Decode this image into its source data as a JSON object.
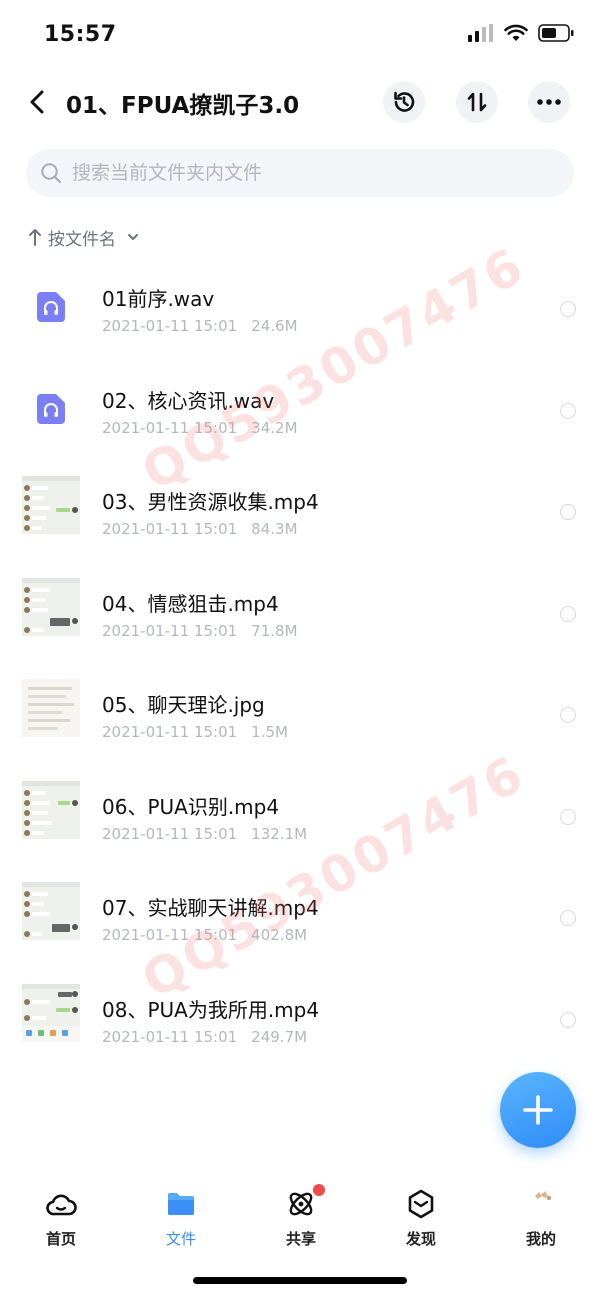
{
  "status": {
    "time": "15:57"
  },
  "header": {
    "title": "01、FPUA撩凯子3.0"
  },
  "search": {
    "placeholder": "搜索当前文件夹内文件"
  },
  "sort": {
    "label": "按文件名"
  },
  "files": [
    {
      "name": "01前序.wav",
      "date": "2021-01-11 15:01",
      "size": "24.6M",
      "type": "audio"
    },
    {
      "name": "02、核心资讯.wav",
      "date": "2021-01-11 15:01",
      "size": "34.2M",
      "type": "audio"
    },
    {
      "name": "03、男性资源收集.mp4",
      "date": "2021-01-11 15:01",
      "size": "84.3M",
      "type": "video"
    },
    {
      "name": "04、情感狙击.mp4",
      "date": "2021-01-11 15:01",
      "size": "71.8M",
      "type": "video"
    },
    {
      "name": "05、聊天理论.jpg",
      "date": "2021-01-11 15:01",
      "size": "1.5M",
      "type": "image"
    },
    {
      "name": "06、PUA识别.mp4",
      "date": "2021-01-11 15:01",
      "size": "132.1M",
      "type": "video"
    },
    {
      "name": "07、实战聊天讲解.mp4",
      "date": "2021-01-11 15:01",
      "size": "402.8M",
      "type": "video"
    },
    {
      "name": "08、PUA为我所用.mp4",
      "date": "2021-01-11 15:01",
      "size": "249.7M",
      "type": "video"
    }
  ],
  "watermark": {
    "text": "QQ593007476"
  },
  "tabs": [
    {
      "label": "首页"
    },
    {
      "label": "文件"
    },
    {
      "label": "共享"
    },
    {
      "label": "发现"
    },
    {
      "label": "我的"
    }
  ],
  "colors": {
    "accent": "#3b8ef6",
    "audio_icon": "#7b7ff5",
    "badge": "#f04a4a"
  }
}
